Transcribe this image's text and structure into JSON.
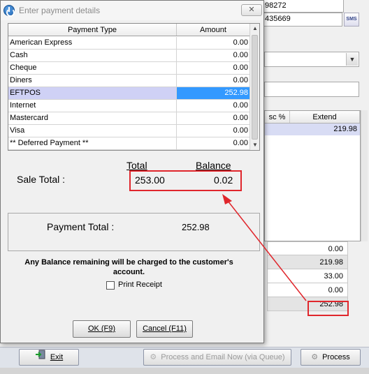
{
  "background": {
    "field_top_1": "98272",
    "field_top_2": "435669",
    "sms_label": "SMS",
    "grid_headers": [
      "sc %",
      "Extend"
    ],
    "grid_rows": [
      [
        "",
        "219.98"
      ]
    ],
    "totals": [
      "0.00",
      "219.98",
      "33.00",
      "0.00",
      "252.98"
    ],
    "buttons": {
      "exit": "Exit",
      "process_email": "Process and Email Now (via Queue)",
      "process": "Process"
    }
  },
  "dialog": {
    "title": "Enter payment details",
    "close": "✕",
    "grid": {
      "headers": [
        "Payment Type",
        "Amount"
      ],
      "rows": [
        {
          "type": "American Express",
          "amount": "0.00"
        },
        {
          "type": "Cash",
          "amount": "0.00"
        },
        {
          "type": "Cheque",
          "amount": "0.00"
        },
        {
          "type": "Diners",
          "amount": "0.00"
        },
        {
          "type": "EFTPOS",
          "amount": "252.98",
          "selected": true
        },
        {
          "type": "Internet",
          "amount": "0.00"
        },
        {
          "type": "Mastercard",
          "amount": "0.00"
        },
        {
          "type": "Visa",
          "amount": "0.00"
        },
        {
          "type": "** Deferred Payment **",
          "amount": "0.00"
        }
      ]
    },
    "total_header": "Total",
    "balance_header": "Balance",
    "sale_total_label": "Sale Total :",
    "sale_total_value": "253.00",
    "balance_value": "0.02",
    "payment_total_label": "Payment Total :",
    "payment_total_value": "252.98",
    "notice": "Any Balance remaining will be charged to the customer's account.",
    "print_receipt_label": "Print Receipt",
    "print_receipt_checked": false,
    "ok_button": "OK (F9)",
    "cancel_button": "Cancel (F11)"
  },
  "colors": {
    "highlight": "#e0262c",
    "selection": "#3399ff",
    "selection_row": "#cfd1f5"
  }
}
